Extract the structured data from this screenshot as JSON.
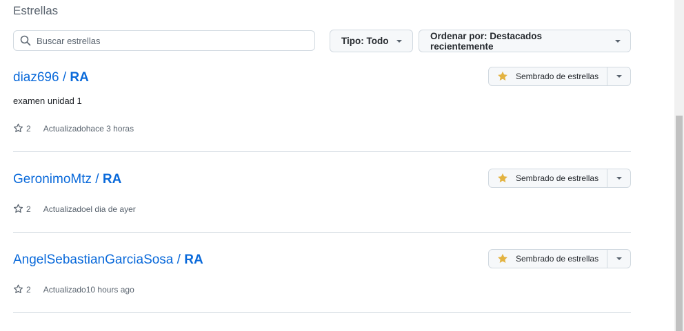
{
  "section_title": "Estrellas",
  "search": {
    "placeholder": "Buscar estrellas",
    "value": ""
  },
  "filters": {
    "type_label": "Tipo: Todo",
    "sort_label": "Ordenar por: Destacados recientemente"
  },
  "colors": {
    "link": "#0969da",
    "star_filled": "#e3b341",
    "border": "#d1d9e0",
    "muted": "#59636e"
  },
  "repos": [
    {
      "owner": "diaz696",
      "separator": " / ",
      "name": "RA",
      "description": "examen unidad 1",
      "stars": "2",
      "updated": "Actualizadohace 3 horas",
      "star_button_label": "Sembrado de estrellas"
    },
    {
      "owner": "GeronimoMtz",
      "separator": " / ",
      "name": "RA",
      "description": "",
      "stars": "2",
      "updated": "Actualizadoel dia de ayer",
      "star_button_label": "Sembrado de estrellas"
    },
    {
      "owner": "AngelSebastianGarciaSosa",
      "separator": " / ",
      "name": "RA",
      "description": "",
      "stars": "2",
      "updated": "Actualizado10 hours ago",
      "star_button_label": "Sembrado de estrellas"
    }
  ]
}
